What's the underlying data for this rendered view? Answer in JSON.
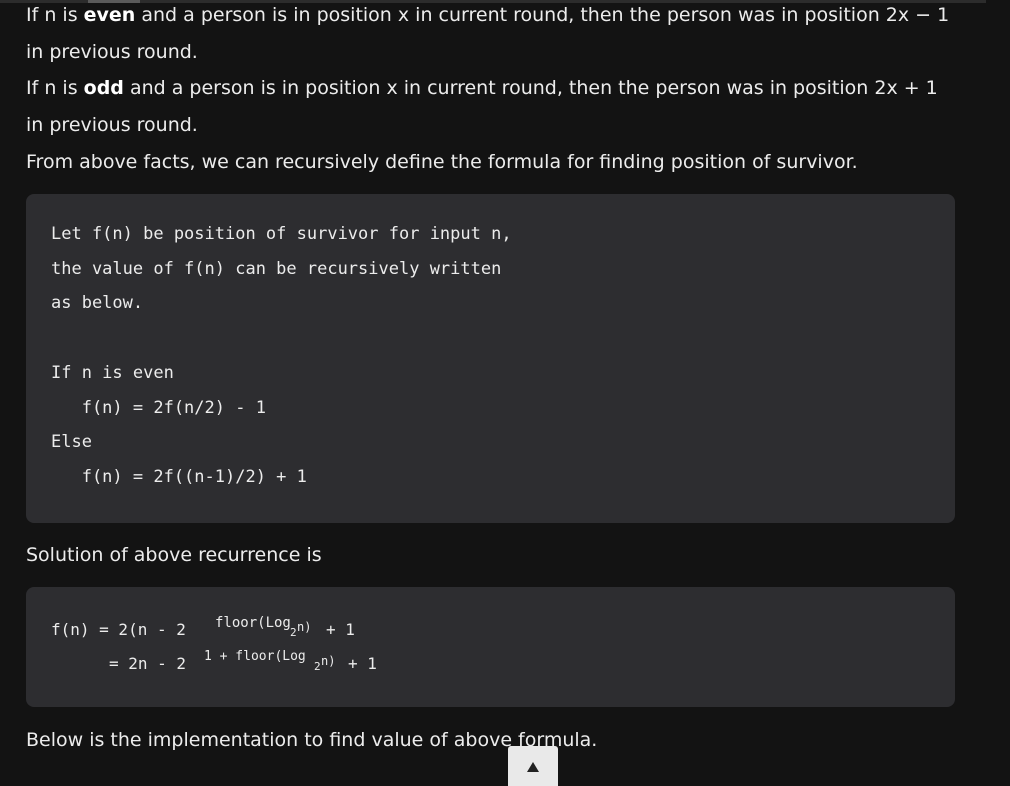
{
  "article": {
    "para1": {
      "pre": "If n is ",
      "bold": "even",
      "post": " and a person is in position x in current round, then the person was in position 2x − 1",
      "line2": "in previous round."
    },
    "para2": {
      "pre": "If n is ",
      "bold": "odd",
      "post": " and a person is in position x in current round, then the person was in position 2x + 1",
      "line2": "in previous round."
    },
    "para3": "From above facts, we can recursively define the formula for finding position of survivor.",
    "code1": {
      "lines": [
        "Let f(n) be position of survivor for input n,",
        "the value of f(n) can be recursively written",
        "as below.",
        "If n is even",
        "   f(n) = 2f(n/2) - 1",
        "Else",
        "   f(n) = 2f((n-1)/2) + 1"
      ]
    },
    "para4": "Solution of above recurrence is",
    "code2": {
      "line1_start": "f(n) = 2(n - 2",
      "line1_sup": "floor(Log",
      "line1_sub": "2",
      "line1_sup_end": "n)",
      "line1_end": "+ 1",
      "line2_start": "= 2n - 2",
      "line2_sup": "1 + floor(Log",
      "line2_sub": "2",
      "line2_sup_end": "n)",
      "line2_end": "+ 1"
    },
    "para5": "Below is the implementation to find value of above formula."
  },
  "scroll_top": {
    "icon": "up-arrow-icon"
  }
}
